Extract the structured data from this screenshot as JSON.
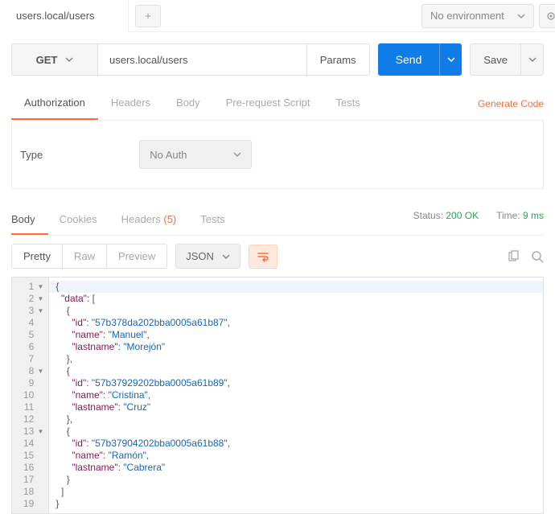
{
  "topbar": {
    "tab_title": "users.local/users",
    "add_label": "+",
    "env_label": "No environment"
  },
  "request": {
    "method": "GET",
    "url": "users.local/users",
    "params_label": "Params",
    "send_label": "Send",
    "save_label": "Save",
    "tabs": {
      "authorization": "Authorization",
      "headers": "Headers",
      "body": "Body",
      "prerequest": "Pre-request Script",
      "tests": "Tests"
    },
    "generate_code": "Generate Code",
    "auth": {
      "type_label": "Type",
      "selected": "No Auth"
    }
  },
  "response": {
    "tabs": {
      "body": "Body",
      "cookies": "Cookies",
      "headers": "Headers",
      "headers_count": "(5)",
      "tests": "Tests"
    },
    "status_label": "Status:",
    "status_value": "200 OK",
    "time_label": "Time:",
    "time_value": "9 ms",
    "view": {
      "pretty": "Pretty",
      "raw": "Raw",
      "preview": "Preview",
      "format": "JSON"
    },
    "body_json": {
      "data": [
        {
          "id": "57b378da202bba0005a61b87",
          "name": "Manuel",
          "lastname": "Morejón"
        },
        {
          "id": "57b37929202bba0005a61b89",
          "name": "Cristina",
          "lastname": "Cruz"
        },
        {
          "id": "57b37904202bba0005a61b88",
          "name": "Ramón",
          "lastname": "Cabrera"
        }
      ]
    },
    "gutter": [
      "1",
      "2",
      "3",
      "4",
      "5",
      "6",
      "7",
      "8",
      "9",
      "10",
      "11",
      "12",
      "13",
      "14",
      "15",
      "16",
      "17",
      "18",
      "19"
    ],
    "fold_lines": [
      1,
      2,
      3,
      8,
      13
    ]
  }
}
